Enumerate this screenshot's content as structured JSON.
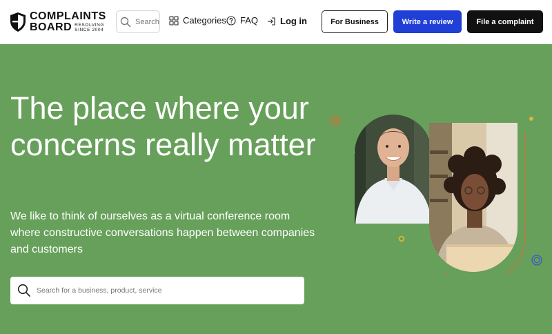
{
  "brand": {
    "line1": "COMPLAINTS",
    "line2": "BOARD",
    "sub1": "RESOLVING",
    "sub2": "SINCE 2004"
  },
  "header": {
    "search_label": "Search",
    "categories_label": "Categories",
    "faq_label": "FAQ",
    "login_label": "Log in",
    "for_business_label": "For Business",
    "write_review_label": "Write a review",
    "file_complaint_label": "File a complaint"
  },
  "hero": {
    "title": "The place where your concerns really matter",
    "description": "We like to think of ourselves as a virtual conference room where constructive conversations happen between companies and customers",
    "search_placeholder": "Search for a business, product, service"
  },
  "colors": {
    "hero_bg": "#67a05a",
    "review_btn": "#1f3fd6",
    "complaint_btn": "#111111",
    "accent_ring_orange": "#c9733b",
    "accent_dot_yellow": "#e0b43c",
    "accent_ring_blue": "#3e63b8"
  }
}
